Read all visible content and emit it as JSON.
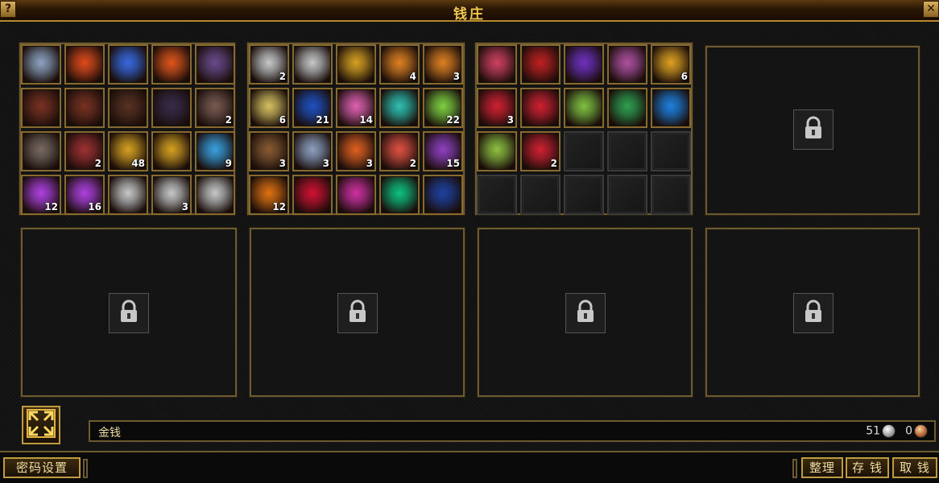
{
  "window": {
    "title": "钱庄",
    "help_glyph": "?",
    "close_glyph": "✕"
  },
  "money": {
    "label": "金钱",
    "silver": "51",
    "copper": "0"
  },
  "buttons": {
    "password": "密码设置",
    "sort": "整理",
    "deposit": "存 钱",
    "withdraw": "取 钱"
  },
  "panel1": {
    "items": [
      {
        "icon": "crystal-icon",
        "color": "#8fa3c0",
        "qty": ""
      },
      {
        "icon": "fire-gem-icon",
        "color": "#e04a1a",
        "qty": ""
      },
      {
        "icon": "blue-flame-icon",
        "color": "#3a6ae0",
        "qty": ""
      },
      {
        "icon": "fire-gem-icon",
        "color": "#e0551a",
        "qty": ""
      },
      {
        "icon": "claw-icon",
        "color": "#6a4a8a",
        "qty": ""
      },
      {
        "icon": "glove-icon",
        "color": "#7a3020",
        "qty": ""
      },
      {
        "icon": "glove-icon",
        "color": "#7a3020",
        "qty": ""
      },
      {
        "icon": "armor-icon",
        "color": "#5a3020",
        "qty": ""
      },
      {
        "icon": "ring-icon",
        "color": "#3a2a4a",
        "qty": ""
      },
      {
        "icon": "ore-icon",
        "color": "#7a5a50",
        "qty": "2"
      },
      {
        "icon": "ore-icon",
        "color": "#7a6a60",
        "qty": ""
      },
      {
        "icon": "ore-red-icon",
        "color": "#a03030",
        "qty": "2"
      },
      {
        "icon": "gold-ingot-icon",
        "color": "#d8a020",
        "qty": "48"
      },
      {
        "icon": "gold-ingot-icon",
        "color": "#d8a020",
        "qty": ""
      },
      {
        "icon": "water-orb-icon",
        "color": "#3aa0e0",
        "qty": "9"
      },
      {
        "icon": "purple-orb-icon",
        "color": "#b040e0",
        "qty": "12"
      },
      {
        "icon": "purple-orb-icon",
        "color": "#b040e0",
        "qty": "16"
      },
      {
        "icon": "scroll-icon",
        "color": "#c8c8c8",
        "qty": ""
      },
      {
        "icon": "scroll-icon",
        "color": "#c8c8c8",
        "qty": "3"
      },
      {
        "icon": "scroll-icon",
        "color": "#c8c8c8",
        "qty": ""
      }
    ]
  },
  "panel2": {
    "items": [
      {
        "icon": "scroll-icon",
        "color": "#c8c8c8",
        "qty": "2"
      },
      {
        "icon": "scroll-icon",
        "color": "#c8c8c8",
        "qty": ""
      },
      {
        "icon": "gold-scroll-icon",
        "color": "#d8a020",
        "qty": ""
      },
      {
        "icon": "orange-scroll-icon",
        "color": "#e08020",
        "qty": "4"
      },
      {
        "icon": "orange-scroll-icon",
        "color": "#e08020",
        "qty": "3"
      },
      {
        "icon": "book-icon",
        "color": "#d8c060",
        "qty": "6"
      },
      {
        "icon": "rune-book-icon",
        "color": "#2050c0",
        "qty": "21"
      },
      {
        "icon": "pink-gem-icon",
        "color": "#e060b0",
        "qty": "14"
      },
      {
        "icon": "teal-orb-icon",
        "color": "#30c0b0",
        "qty": ""
      },
      {
        "icon": "green-burst-icon",
        "color": "#80d040",
        "qty": "22"
      },
      {
        "icon": "chest-icon",
        "color": "#8a5a30",
        "qty": "3"
      },
      {
        "icon": "pearl-icon",
        "color": "#90a0c0",
        "qty": "3"
      },
      {
        "icon": "feather-icon",
        "color": "#e06020",
        "qty": "3"
      },
      {
        "icon": "jade-ring-icon",
        "color": "#e05040",
        "qty": "2"
      },
      {
        "icon": "molecule-icon",
        "color": "#9040c0",
        "qty": "15"
      },
      {
        "icon": "pumpkin-icon",
        "color": "#e07010",
        "qty": "12"
      },
      {
        "icon": "red-spark-icon",
        "color": "#d01030",
        "qty": ""
      },
      {
        "icon": "pink-spark-icon",
        "color": "#d030a0",
        "qty": ""
      },
      {
        "icon": "green-spiral-icon",
        "color": "#10c080",
        "qty": ""
      },
      {
        "icon": "night-city-icon",
        "color": "#2040a0",
        "qty": ""
      }
    ]
  },
  "panel3": {
    "items": [
      {
        "icon": "rainbow-scroll-icon",
        "color": "#d04060",
        "qty": ""
      },
      {
        "icon": "demon-face-icon",
        "color": "#c02020",
        "qty": ""
      },
      {
        "icon": "purple-beast-icon",
        "color": "#7030c0",
        "qty": ""
      },
      {
        "icon": "pearl-burst-icon",
        "color": "#b050a0",
        "qty": ""
      },
      {
        "icon": "tent-icon",
        "color": "#e0a020",
        "qty": "6"
      },
      {
        "icon": "ruby-icon",
        "color": "#d02030",
        "qty": "3"
      },
      {
        "icon": "ruby-icon",
        "color": "#d02030",
        "qty": ""
      },
      {
        "icon": "peridot-icon",
        "color": "#80c040",
        "qty": ""
      },
      {
        "icon": "jade-icon",
        "color": "#30a050",
        "qty": ""
      },
      {
        "icon": "sapphire-icon",
        "color": "#2080e0",
        "qty": ""
      },
      {
        "icon": "peridot-icon",
        "color": "#90c040",
        "qty": ""
      },
      {
        "icon": "ruby-icon",
        "color": "#d02030",
        "qty": "2"
      },
      {
        "icon": "empty",
        "color": "",
        "qty": ""
      },
      {
        "icon": "empty",
        "color": "",
        "qty": ""
      },
      {
        "icon": "empty",
        "color": "",
        "qty": ""
      },
      {
        "icon": "empty",
        "color": "",
        "qty": ""
      },
      {
        "icon": "empty",
        "color": "",
        "qty": ""
      },
      {
        "icon": "empty",
        "color": "",
        "qty": ""
      },
      {
        "icon": "empty",
        "color": "",
        "qty": ""
      },
      {
        "icon": "empty",
        "color": "",
        "qty": ""
      }
    ]
  },
  "locked_panels": [
    "panel4",
    "panel5",
    "panel6",
    "panel7",
    "panel8"
  ]
}
